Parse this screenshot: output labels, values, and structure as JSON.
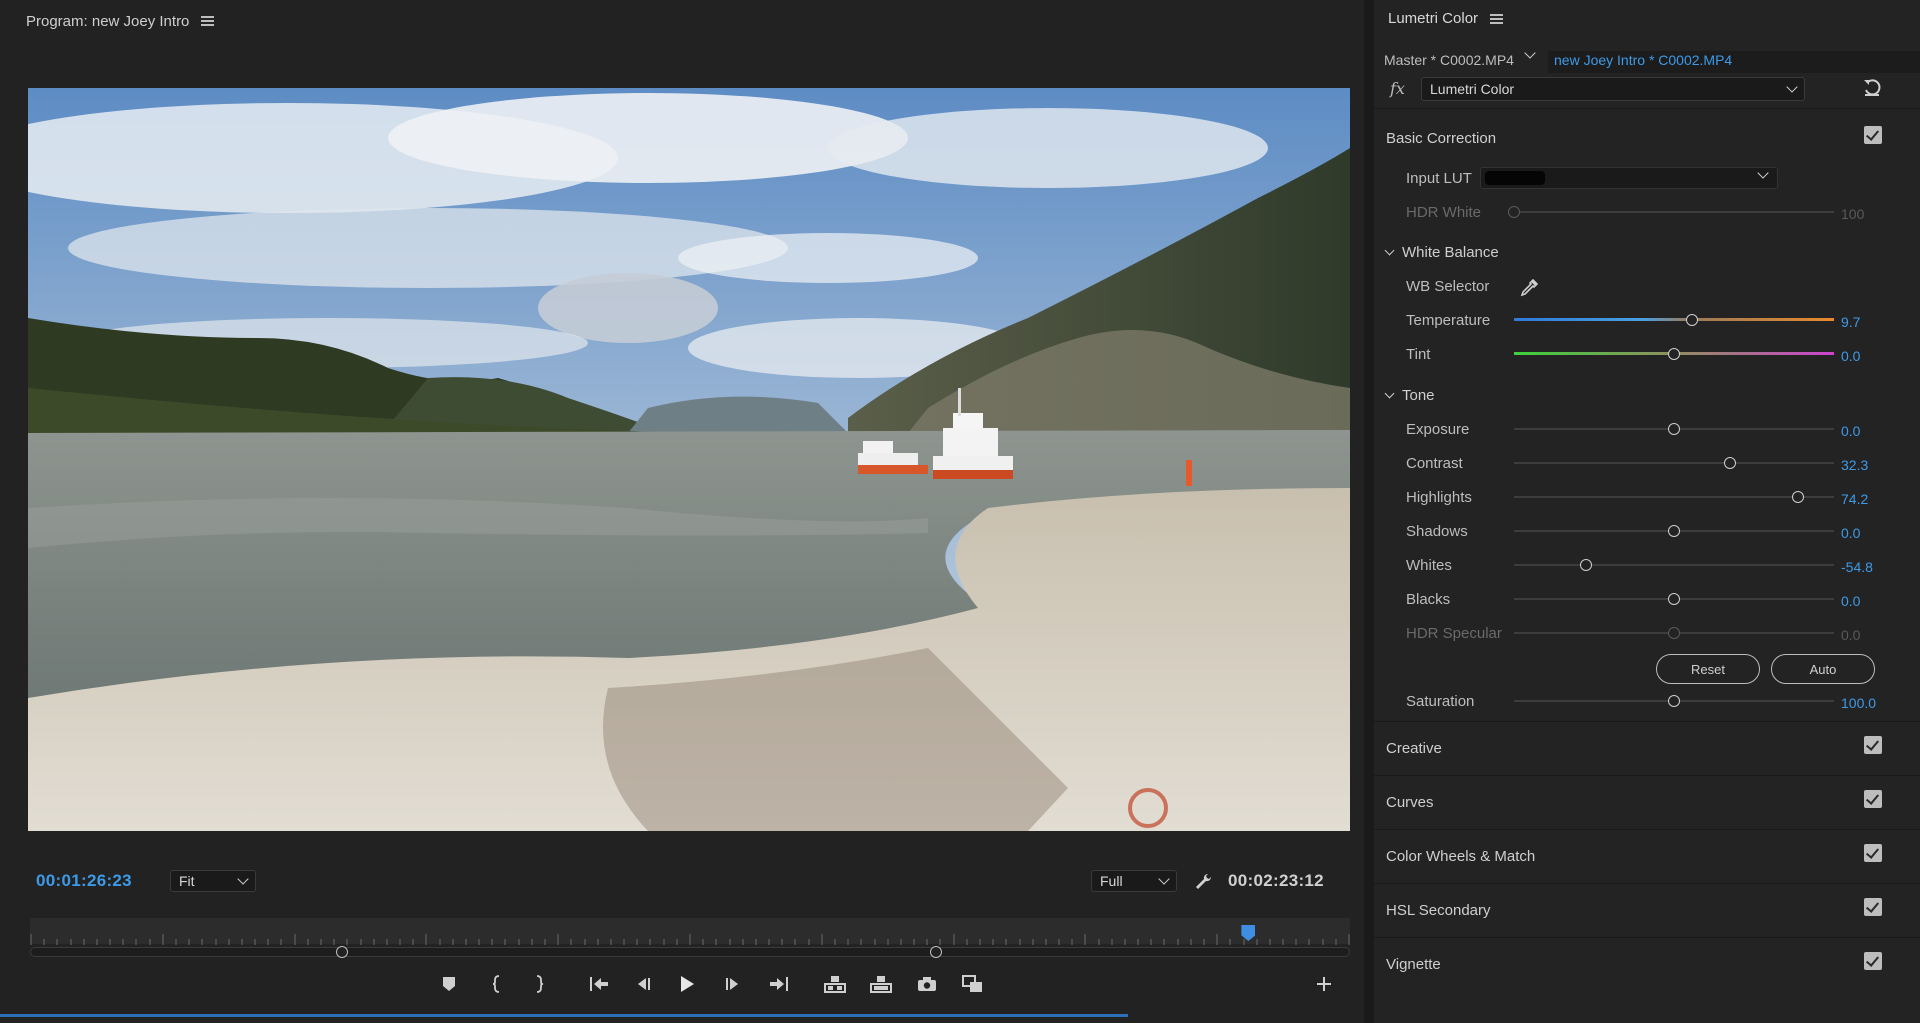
{
  "program_monitor": {
    "title": "Program: new Joey Intro",
    "current_timecode": "00:01:26:23",
    "total_timecode": "00:02:23:12",
    "zoom": "Fit",
    "resolution": "Full",
    "playhead_fraction": 0.923,
    "in_point_fraction": 0.236,
    "out_point_fraction": 0.686
  },
  "lumetri": {
    "title": "Lumetri Color",
    "master_clip": "Master * C0002.MP4",
    "sequence_clip": "new Joey Intro * C0002.MP4",
    "fx_symbol": "fx",
    "effect_name": "Lumetri Color",
    "basic_correction": {
      "title": "Basic Correction",
      "input_lut_label": "Input LUT",
      "hdr_white": {
        "label": "HDR White",
        "value": "100",
        "fraction": 0.0
      },
      "white_balance": {
        "title": "White Balance",
        "wb_selector_label": "WB Selector",
        "temperature": {
          "label": "Temperature",
          "value": "9.7",
          "fraction": 0.557
        },
        "tint": {
          "label": "Tint",
          "value": "0.0",
          "fraction": 0.5
        }
      },
      "tone": {
        "title": "Tone",
        "exposure": {
          "label": "Exposure",
          "value": "0.0",
          "fraction": 0.5
        },
        "contrast": {
          "label": "Contrast",
          "value": "32.3",
          "fraction": 0.675
        },
        "highlights": {
          "label": "Highlights",
          "value": "74.2",
          "fraction": 0.888
        },
        "shadows": {
          "label": "Shadows",
          "value": "0.0",
          "fraction": 0.5
        },
        "whites": {
          "label": "Whites",
          "value": "-54.8",
          "fraction": 0.226
        },
        "blacks": {
          "label": "Blacks",
          "value": "0.0",
          "fraction": 0.5
        },
        "hdr_specular": {
          "label": "HDR Specular",
          "value": "0.0",
          "fraction": 0.5
        },
        "reset_label": "Reset",
        "auto_label": "Auto"
      },
      "saturation": {
        "label": "Saturation",
        "value": "100.0",
        "fraction": 0.5
      }
    },
    "sections": [
      "Creative",
      "Curves",
      "Color Wheels & Match",
      "HSL Secondary",
      "Vignette"
    ]
  }
}
